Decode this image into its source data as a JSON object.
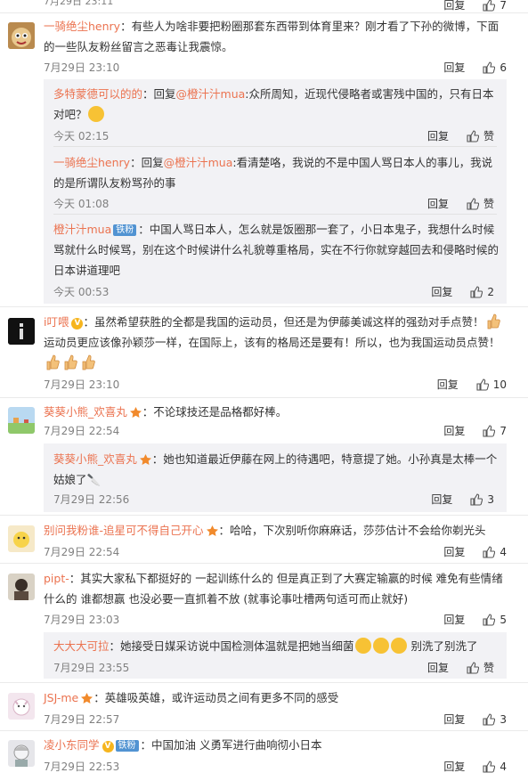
{
  "top": {
    "time": "7月29日 23:11",
    "reply": "回复",
    "likes": "7"
  },
  "comments": [
    {
      "name": "一骑绝尘henry",
      "text": "：有些人为啥非要把粉圈那套东西带到体育里来？刚才看了下孙的微博，下面的一些队友粉丝留言之恶毒让我震惊。",
      "time": "7月29日 23:10",
      "reply": "回复",
      "likes": "6",
      "subs": [
        {
          "name": "多特蒙德可以的的",
          "pre": "：回复",
          "mention": "@橙汁汁mua",
          "text": ":众所周知，近现代侵略者或害残中国的，只有日本对吧？",
          "time": "今天 02:15",
          "reply": "回复",
          "likes": "赞"
        },
        {
          "name": "一骑绝尘henry",
          "pre": "：回复",
          "mention": "@橙汁汁mua",
          "text": ":看清楚咯，我说的不是中国人骂日本人的事儿，我说的是所谓队友粉骂孙的事",
          "time": "今天 01:08",
          "reply": "回复",
          "likes": "赞"
        },
        {
          "name": "橙汁汁mua",
          "badge": "铁粉",
          "text": "：中国人骂日本人，怎么就是饭圈那一套了，小日本鬼子，我想什么时候骂就什么时候骂，别在这个时候讲什么礼貌尊重格局，实在不行你就穿越回去和侵略时候的日本讲道理吧",
          "time": "今天 00:53",
          "reply": "回复",
          "likes": "2"
        }
      ]
    },
    {
      "name": "i叮喂",
      "text1": "：虽然希望获胜的全都是我国的运动员，但还是为伊藤美诚这样的强劲对手点赞！",
      "text2": "运动员更应该像孙颖莎一样，在国际上，该有的格局还是要有！所以，也为我国运动员点赞！",
      "time": "7月29日 23:10",
      "reply": "回复",
      "likes": "10"
    },
    {
      "name": "葵葵小熊_欢喜丸",
      "text": "：不论球技还是品格都好棒。",
      "time": "7月29日 22:54",
      "reply": "回复",
      "likes": "7",
      "subs": [
        {
          "name": "葵葵小熊_欢喜丸",
          "text": "：她也知道最近伊藤在网上的待遇吧，特意提了她。小孙真是太棒一个姑娘了🔪",
          "time": "7月29日 22:56",
          "reply": "回复",
          "likes": "3"
        }
      ]
    },
    {
      "name": "别问我粉谁-追星可不得自己开心",
      "text": "：哈哈，下次别听你麻麻话，莎莎估计不会给你剃光头",
      "time": "7月29日 22:54",
      "reply": "回复",
      "likes": "4"
    },
    {
      "name": "pipt-",
      "text": "：其实大家私下都挺好的 一起训练什么的 但是真正到了大赛定输赢的时候 难免有些情绪什么的 谁都想赢 也没必要一直抓着不放 (就事论事吐槽两句适可而止就好)",
      "time": "7月29日 23:03",
      "reply": "回复",
      "likes": "5",
      "subs": [
        {
          "name": "大大大可拉",
          "text": "：她接受日媒采访说中国检测体温就是把她当细菌",
          "text2": " 别洗了别洗了",
          "time": "7月29日 23:55",
          "reply": "回复",
          "likes": "赞"
        }
      ]
    },
    {
      "name": "JSJ-me",
      "text": "：英雄吸英雄，或许运动员之间有更多不同的感受",
      "time": "7月29日 22:57",
      "reply": "回复",
      "likes": "3"
    },
    {
      "name": "凌小东同学",
      "badge": "铁粉",
      "text": "：中国加油 义勇军进行曲响彻小日本",
      "time": "7月29日 22:53",
      "reply": "回复",
      "likes": "4"
    }
  ]
}
